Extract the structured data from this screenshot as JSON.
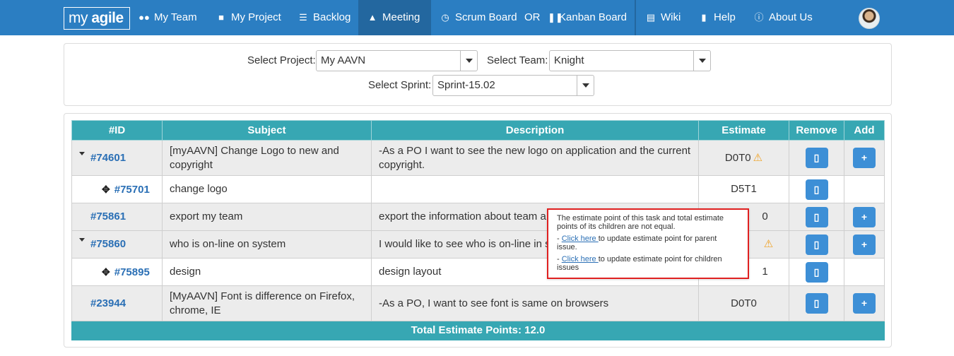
{
  "nav": {
    "logo_prefix": "my ",
    "logo_bold": "agile",
    "items": [
      {
        "label": "My Team",
        "icon": "users-icon"
      },
      {
        "label": "My Project",
        "icon": "folder-icon"
      },
      {
        "label": "Backlog",
        "icon": "list-icon"
      },
      {
        "label": "Meeting",
        "icon": "sitemap-icon",
        "active": true
      },
      {
        "label": "Scrum Board",
        "icon": "clock-icon"
      },
      {
        "label": "OR",
        "icon": ""
      },
      {
        "label": "Kanban Board",
        "icon": "columns-icon"
      },
      {
        "label": "Wiki",
        "icon": "table-icon"
      },
      {
        "label": "Help",
        "icon": "book-icon"
      },
      {
        "label": "About Us",
        "icon": "info-icon"
      }
    ]
  },
  "filters": {
    "project_label": "Select Project:",
    "project_value": "My AAVN",
    "team_label": "Select Team:",
    "team_value": "Knight",
    "sprint_label": "Select Sprint:",
    "sprint_value": "Sprint-15.02"
  },
  "table": {
    "headers": [
      "#ID",
      "Subject",
      "Description",
      "Estimate",
      "Remove",
      "Add"
    ],
    "rows": [
      {
        "id": "#74601",
        "subject": "[myAAVN] Change Logo to new and copyright",
        "description": "-As a PO I want to see the new logo on application and the current copyright.",
        "estimate": "D0T0",
        "warning": true,
        "parent": true
      },
      {
        "id": "#75701",
        "subject": "change logo",
        "description": "",
        "estimate": "D5T1",
        "warning": false,
        "child": true
      },
      {
        "id": "#75861",
        "subject": "export my team",
        "description": "export the information about team a",
        "estimate": "0",
        "warning": false
      },
      {
        "id": "#75860",
        "subject": "who is on-line on system",
        "description": "I would like to see who is on-line in s",
        "estimate": "",
        "warning": true,
        "parent": true
      },
      {
        "id": "#75895",
        "subject": "design",
        "description": "design layout",
        "estimate": "1",
        "warning": false,
        "child": true
      },
      {
        "id": "#23944",
        "subject": "[MyAAVN] Font is difference on Firefox, chrome, IE",
        "description": "-As a PO, I want to see font is same on browsers",
        "estimate": "D0T0",
        "warning": false
      }
    ],
    "total": "Total Estimate Points: 12.0"
  },
  "tooltip": {
    "message": "The estimate point of this task and total estimate points of its children are not equal.",
    "dash": "- ",
    "link_text": "Click here ",
    "parent_text": "to update estimate point for parent issue.",
    "children_text": "to update estimate point for children issues"
  },
  "colors": {
    "navbar": "#2b7ec2",
    "table_header": "#37a7b3",
    "button": "#3d8fd6",
    "tooltip_border": "#e02020",
    "warning": "#f0a020"
  }
}
